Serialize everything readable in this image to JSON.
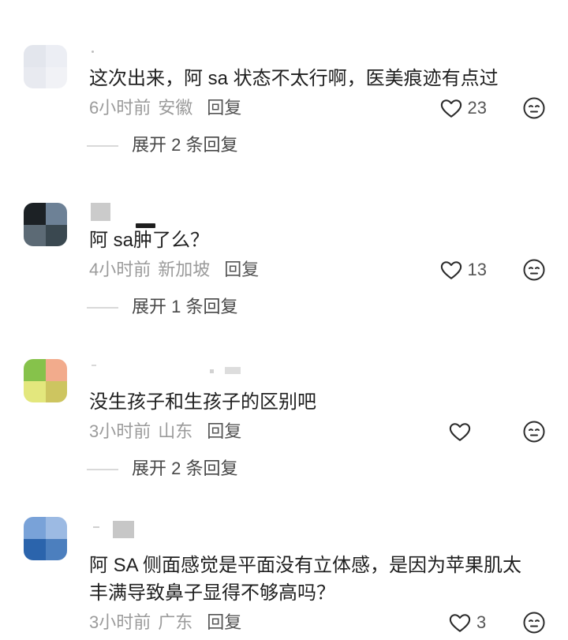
{
  "theme": {
    "text": "#1f1f1f",
    "meta": "#9b9b9b",
    "reply": "#555555",
    "count": "#555555",
    "icon": "#2b2b2b",
    "expand": "#474747",
    "divider": "#d9d9d9"
  },
  "icons": {
    "like": "heart-outline-icon",
    "dislike": "dislike-face-icon"
  },
  "comments": [
    {
      "avatar_colors": [
        "#e3e6ed",
        "#eceef4",
        "#e8eaf0",
        "#f1f2f6"
      ],
      "text": "这次出来，阿 sa 状态不太行啊，医美痕迹有点过",
      "time": "6小时前",
      "location": "安徽",
      "reply_label": "回复",
      "likes": "23",
      "expand_replies": "展开 2 条回复"
    },
    {
      "avatar_colors": [
        "#1c2125",
        "#6d8196",
        "#5c6a75",
        "#3a4850"
      ],
      "text": "阿 sa肿了么？",
      "time": "4小时前",
      "location": "新加坡",
      "reply_label": "回复",
      "likes": "13",
      "expand_replies": "展开 1 条回复"
    },
    {
      "avatar_colors": [
        "#86c24b",
        "#f2ab8c",
        "#e3e77d",
        "#cdc560"
      ],
      "text": "没生孩子和生孩子的区别吧",
      "time": "3小时前",
      "location": "山东",
      "reply_label": "回复",
      "expand_replies": "展开 2 条回复"
    },
    {
      "avatar_colors": [
        "#79a2d8",
        "#9cbae3",
        "#2b64ac",
        "#4c7fbe"
      ],
      "text": "阿 SA 侧面感觉是平面没有立体感，是因为苹果肌太丰满导致鼻子显得不够高吗？",
      "time": "3小时前",
      "location": "广东",
      "reply_label": "回复",
      "likes": "3"
    }
  ]
}
